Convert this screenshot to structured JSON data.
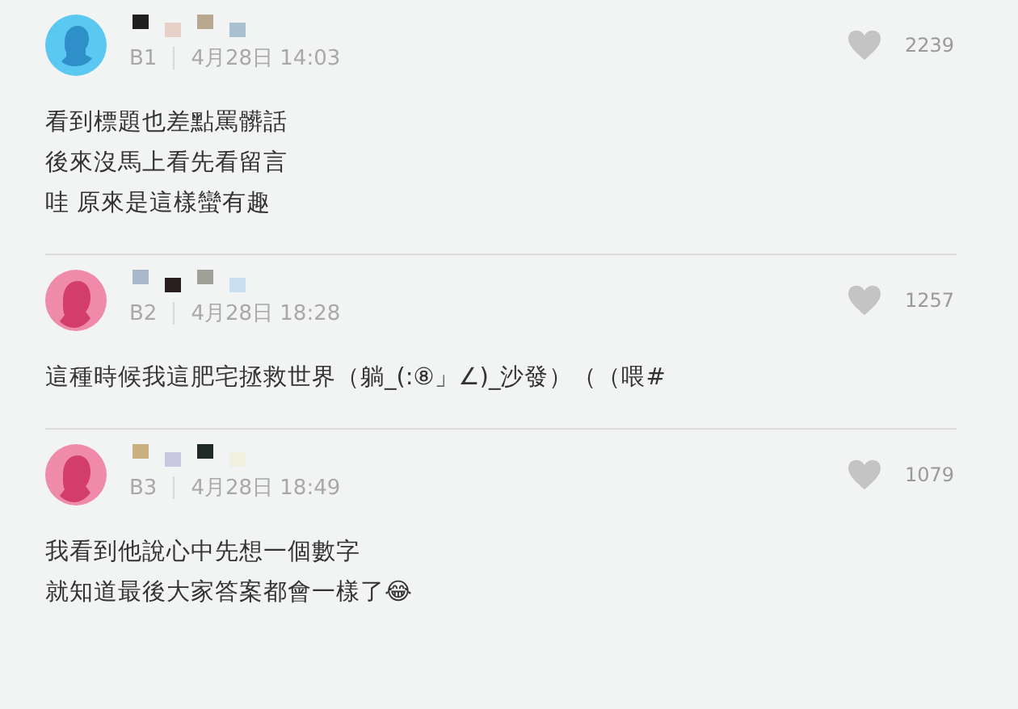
{
  "comments": [
    {
      "kind": "male",
      "floor": "B1",
      "time": "4月28日 14:03",
      "likes": "2239",
      "lines": [
        "看到標題也差點罵髒話",
        "後來沒馬上看先看留言",
        "哇 原來是這樣蠻有趣"
      ]
    },
    {
      "kind": "female",
      "floor": "B2",
      "time": "4月28日 18:28",
      "likes": "1257",
      "lines": [
        "這種時候我這肥宅拯救世界（躺_(:⑧」∠)_沙發）（（喂#"
      ]
    },
    {
      "kind": "female",
      "floor": "B3",
      "time": "4月28日 18:49",
      "likes": "1079",
      "lines": [
        "我看到他說心中先想一個數字",
        "就知道最後大家答案都會一樣了😂"
      ]
    }
  ]
}
